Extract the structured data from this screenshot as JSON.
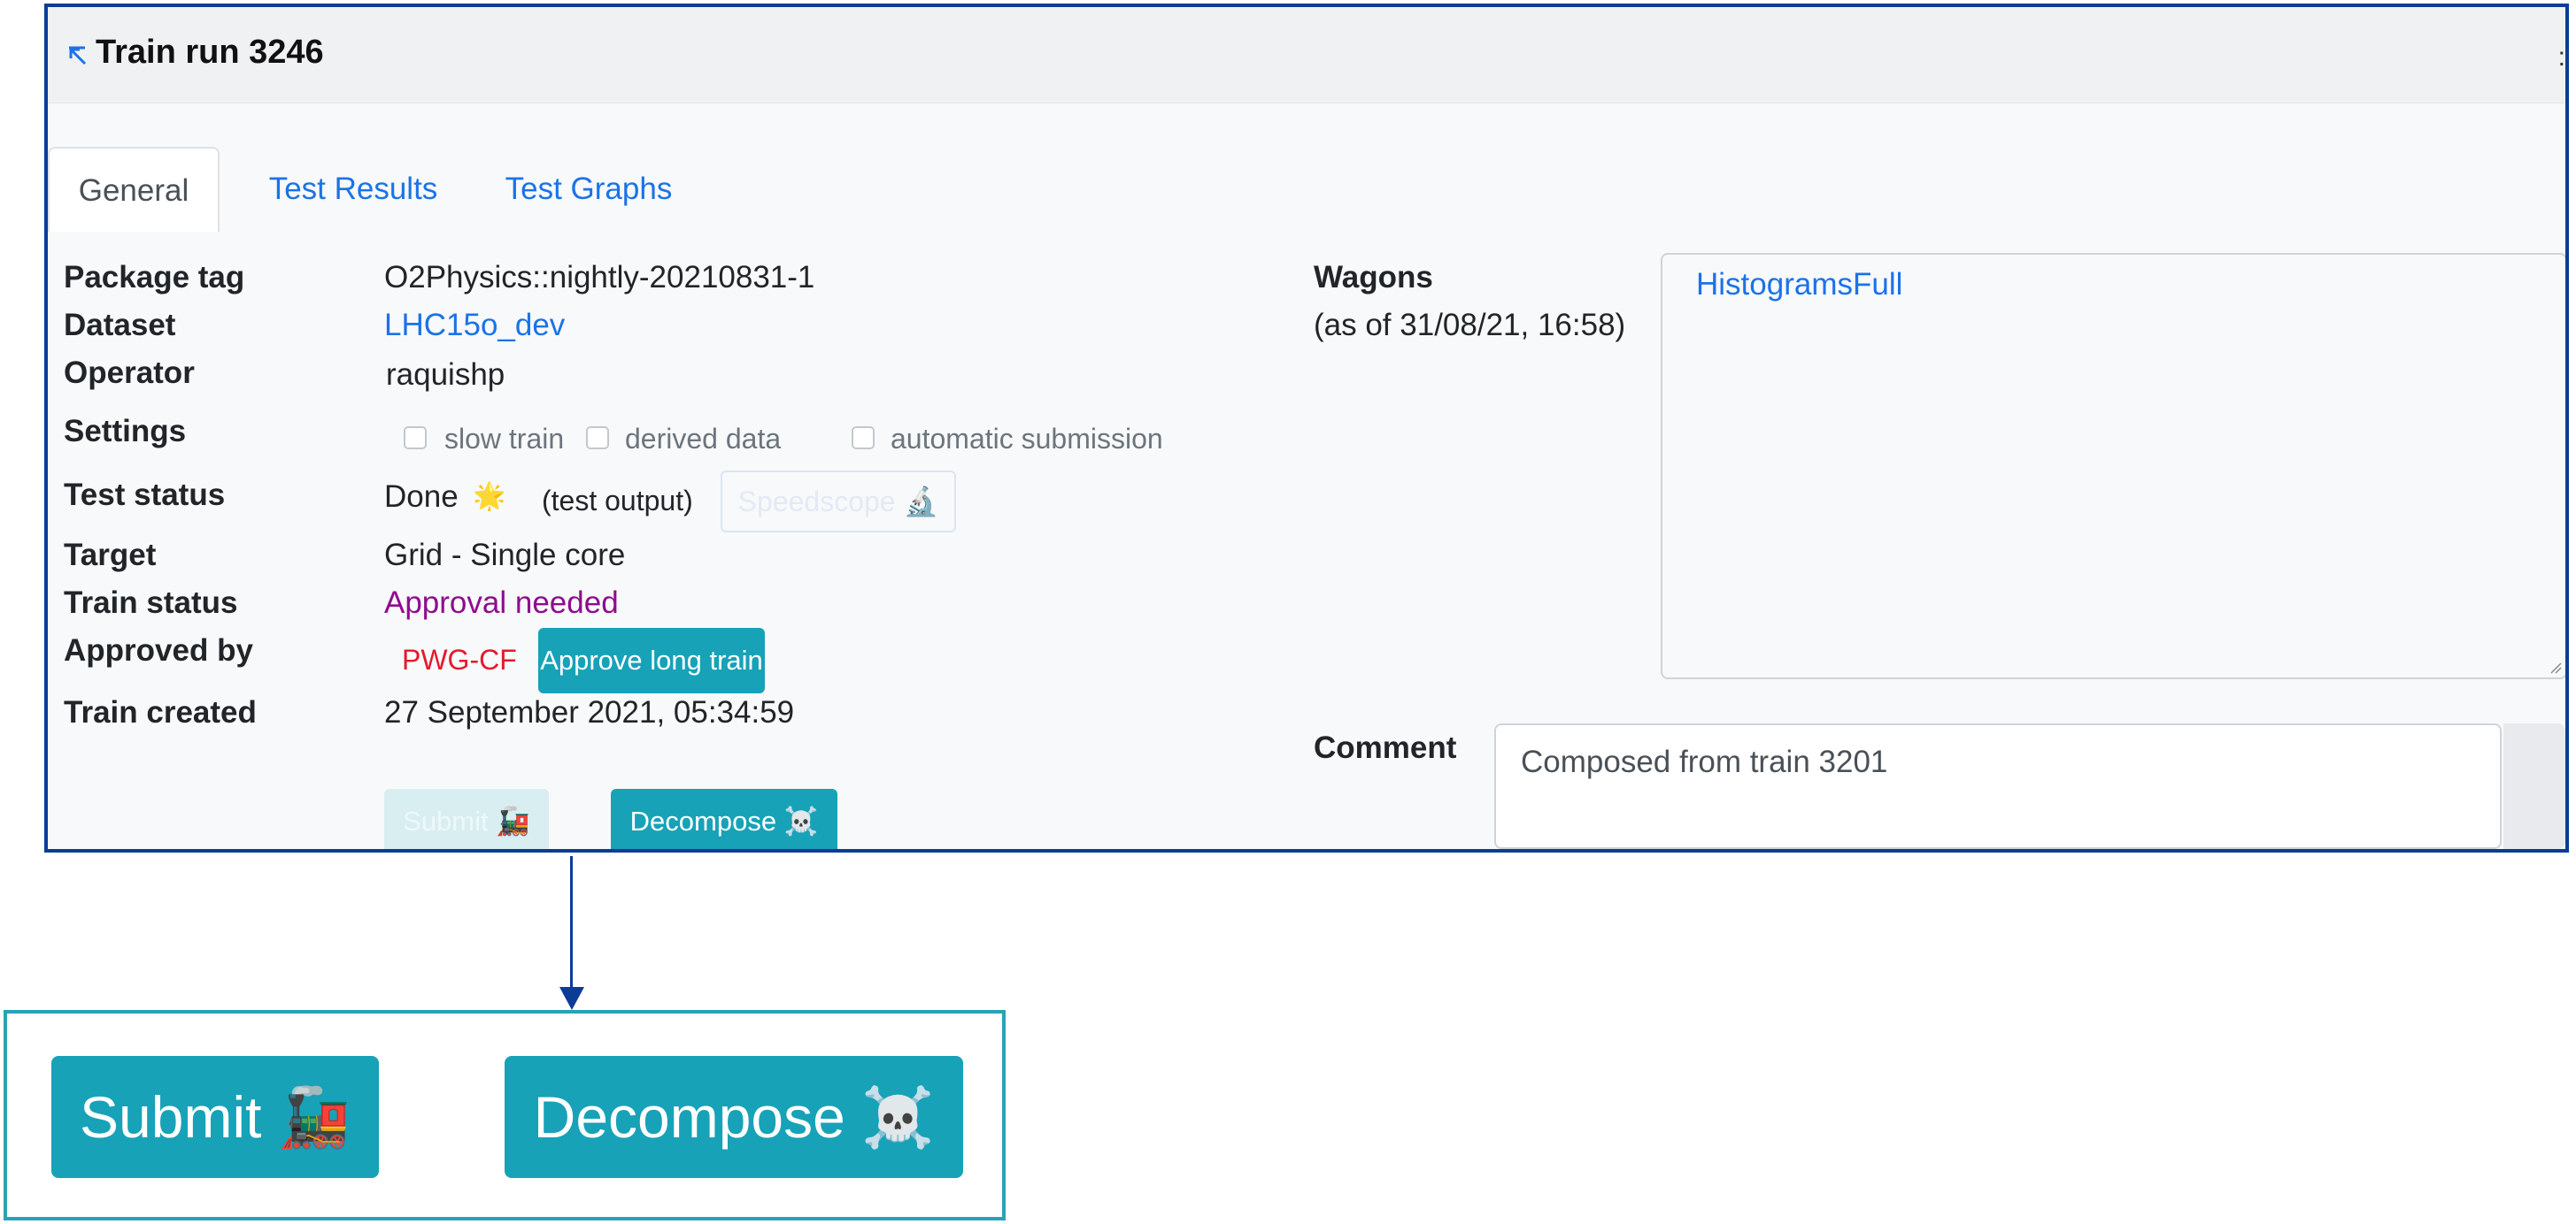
{
  "panel": {
    "title": "Train run 3246",
    "collapse_icon_name": "collapse-arrow-icon"
  },
  "tabs": [
    {
      "label": "General",
      "active": true
    },
    {
      "label": "Test Results",
      "active": false
    },
    {
      "label": "Test Graphs",
      "active": false
    }
  ],
  "fields": {
    "package_tag": {
      "label": "Package tag",
      "value": "O2Physics::nightly-20210831-1"
    },
    "dataset": {
      "label": "Dataset",
      "value": "LHC15o_dev"
    },
    "operator": {
      "label": "Operator",
      "value": "raquishp"
    },
    "settings": {
      "label": "Settings",
      "options": [
        {
          "label": "slow train",
          "checked": false
        },
        {
          "label": "derived data",
          "checked": false
        },
        {
          "label": "automatic submission",
          "checked": false
        }
      ]
    },
    "test_status": {
      "label": "Test status",
      "value": "Done",
      "icon": "🌟",
      "output_link": "(test output)",
      "speedscope_label": "Speedscope 🔬"
    },
    "target": {
      "label": "Target",
      "value": "Grid - Single core"
    },
    "train_status": {
      "label": "Train status",
      "value": "Approval needed",
      "color": "#8e0c8e"
    },
    "approved_by": {
      "label": "Approved by",
      "approver": "PWG-CF",
      "approve_button": "Approve long train"
    },
    "train_created": {
      "label": "Train created",
      "value": "27 September 2021, 05:34:59"
    }
  },
  "actions": {
    "submit_label": "Submit 🚂",
    "decompose_label": "Decompose ☠️"
  },
  "wagons": {
    "label": "Wagons",
    "as_of": "(as of 31/08/21, 16:58)",
    "items": [
      "HistogramsFull"
    ]
  },
  "comment": {
    "label": "Comment",
    "value": "Composed from train 3201"
  },
  "zoom": {
    "submit_label": "Submit 🚂",
    "decompose_label": "Decompose ☠️"
  },
  "colors": {
    "accent_button": "#17a2b8",
    "link": "#1a73e8",
    "approver": "#e5192d",
    "panel_border": "#0b3c96",
    "zoom_border": "#29a3b3"
  }
}
